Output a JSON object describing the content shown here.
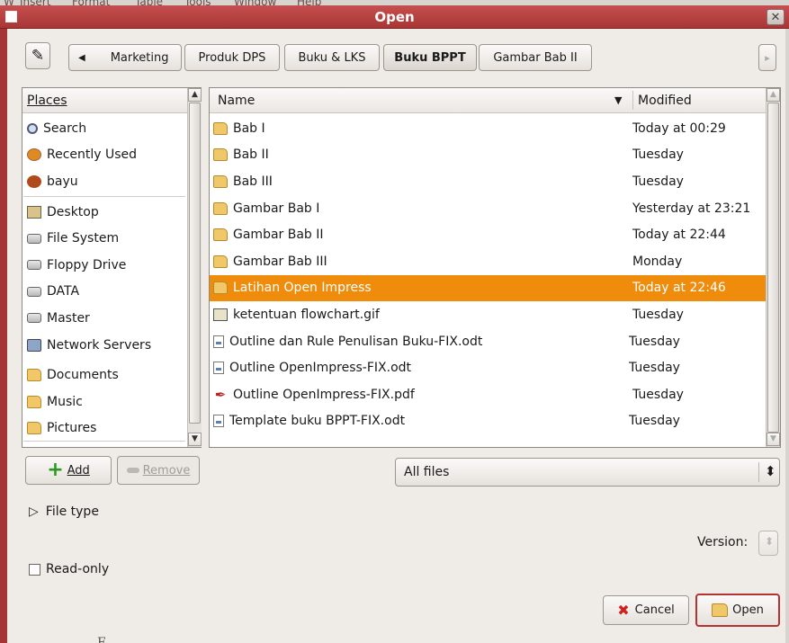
{
  "background_menu": [
    "W",
    "Insert",
    "Format",
    "Table",
    "Tools",
    "Window",
    "Help"
  ],
  "dialog": {
    "title": "Open",
    "close_glyph": "✕"
  },
  "pathbar": {
    "edit_glyph": "✎",
    "back_glyph": "◀",
    "forward_glyph": "▸",
    "crumbs": [
      "Marketing",
      "Produk DPS",
      "Buku & LKS",
      "Buku BPPT",
      "Gambar Bab II"
    ],
    "active_crumb": "Buku BPPT"
  },
  "places": {
    "header": "Places",
    "items": [
      {
        "label": "Search",
        "icon": "search-icon"
      },
      {
        "label": "Recently Used",
        "icon": "recently-used-icon"
      },
      {
        "label": "bayu",
        "icon": "home-icon"
      },
      {
        "label": "Desktop",
        "icon": "desktop-icon"
      },
      {
        "label": "File System",
        "icon": "drive-icon"
      },
      {
        "label": "Floppy Drive",
        "icon": "drive-icon"
      },
      {
        "label": "DATA",
        "icon": "drive-icon"
      },
      {
        "label": "Master",
        "icon": "drive-icon"
      },
      {
        "label": "Network Servers",
        "icon": "network-icon"
      },
      {
        "label": "Documents",
        "icon": "folder-icon"
      },
      {
        "label": "Music",
        "icon": "folder-icon"
      },
      {
        "label": "Pictures",
        "icon": "folder-icon"
      }
    ],
    "add_label": "Add",
    "add_glyph": "+",
    "remove_label": "Remove"
  },
  "files": {
    "col_name": "Name",
    "col_modified": "Modified",
    "sort_glyph": "▼",
    "rows": [
      {
        "name": "Bab I",
        "modified": "Today at 00:29",
        "type": "folder"
      },
      {
        "name": "Bab II",
        "modified": "Tuesday",
        "type": "folder"
      },
      {
        "name": "Bab III",
        "modified": "Tuesday",
        "type": "folder"
      },
      {
        "name": "Gambar Bab I",
        "modified": "Yesterday at 23:21",
        "type": "folder"
      },
      {
        "name": "Gambar Bab II",
        "modified": "Today at 22:44",
        "type": "folder"
      },
      {
        "name": "Gambar Bab III",
        "modified": "Monday",
        "type": "folder"
      },
      {
        "name": "Latihan Open Impress",
        "modified": "Today at 22:46",
        "type": "folder"
      },
      {
        "name": "ketentuan flowchart.gif",
        "modified": "Tuesday",
        "type": "image"
      },
      {
        "name": "Outline dan Rule Penulisan Buku-FIX.odt",
        "modified": "Tuesday",
        "type": "document"
      },
      {
        "name": "Outline OpenImpress-FIX.odt",
        "modified": "Tuesday",
        "type": "document"
      },
      {
        "name": "Outline OpenImpress-FIX.pdf",
        "modified": "Tuesday",
        "type": "pdf"
      },
      {
        "name": "Template buku BPPT-FIX.odt",
        "modified": "Tuesday",
        "type": "document"
      }
    ],
    "selected_index": 6
  },
  "filter": {
    "value": "All files",
    "glyph": "⬍"
  },
  "file_type": {
    "label": "File type",
    "expander_glyph": "▷"
  },
  "version": {
    "label": "Version:"
  },
  "read_only": {
    "label": "Read-only",
    "checked": false
  },
  "buttons": {
    "cancel": "Cancel",
    "open": "Open",
    "cancel_glyph": "✖"
  },
  "bottom_text": "E ...   ...  ...  ... ",
  "colors": {
    "titlebar": "#b03e3e",
    "selection": "#f08c0c",
    "window_bg": "#efebe7"
  }
}
